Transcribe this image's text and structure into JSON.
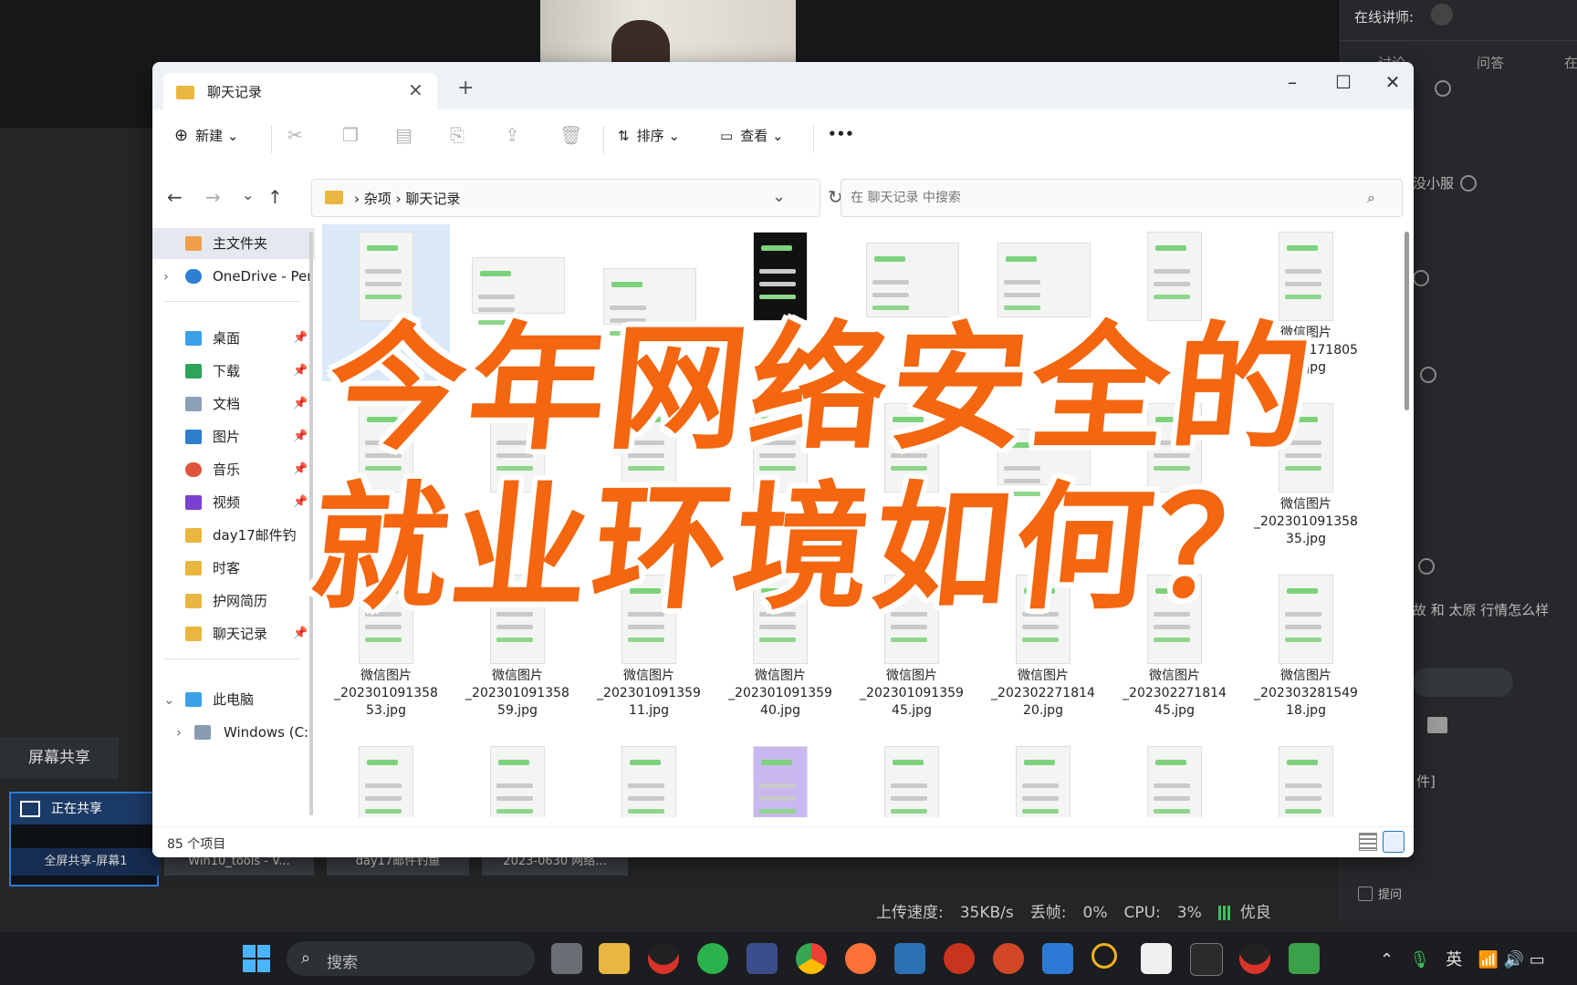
{
  "headline": {
    "line1": "今年网络安全的",
    "line2": "就业环境如何？"
  },
  "conference": {
    "lecturer_label": "在线讲师:",
    "right_tabs": [
      "讨论",
      "问答",
      "在"
    ],
    "right_texts": [
      "没小服",
      "故 和 太原 行情怎么样",
      "件]",
      "提问"
    ],
    "share_tab": "屏幕共享",
    "share_status": "正在共享",
    "thumbnails": [
      "全屏共享-屏幕1",
      "Win10_tools - V...",
      "day17邮件钓鱼",
      "2023-0630 网络..."
    ],
    "status_bar": {
      "upload_label": "上传速度:",
      "upload_value": "35KB/s",
      "drop_label": "丢帧:",
      "drop_value": "0%",
      "cpu_label": "CPU:",
      "cpu_value": "3%",
      "quality": "优良"
    }
  },
  "explorer": {
    "tab_title": "聊天记录",
    "toolbar": {
      "new": "新建",
      "sort": "排序",
      "view": "查看",
      "more": "•••"
    },
    "breadcrumb": [
      "杂项",
      "聊天记录"
    ],
    "search_placeholder": "在 聊天记录 中搜索",
    "sidebar": [
      {
        "label": "主文件夹",
        "icon": "home-icon"
      },
      {
        "label": "OneDrive - Per",
        "icon": "cloud-icon"
      },
      {
        "label": "桌面",
        "icon": "desktop-icon"
      },
      {
        "label": "下载",
        "icon": "download-icon"
      },
      {
        "label": "文档",
        "icon": "document-icon"
      },
      {
        "label": "图片",
        "icon": "picture-icon"
      },
      {
        "label": "音乐",
        "icon": "music-icon"
      },
      {
        "label": "视频",
        "icon": "video-icon"
      },
      {
        "label": "day17邮件钓",
        "icon": "folder-icon"
      },
      {
        "label": "时客",
        "icon": "folder-icon"
      },
      {
        "label": "护网简历",
        "icon": "folder-icon"
      },
      {
        "label": "聊天记录",
        "icon": "folder-icon"
      },
      {
        "label": "此电脑",
        "icon": "computer-icon"
      },
      {
        "label": "Windows (C:)",
        "icon": "drive-icon"
      }
    ],
    "files_row1": [
      "",
      "",
      "",
      "",
      "",
      "",
      "",
      "微信图片\n_202209171805\n10.jpg"
    ],
    "files_row2": [
      "",
      "",
      "",
      "",
      "",
      "",
      "",
      "微信图片\n_202301091358\n35.jpg"
    ],
    "files_row3": [
      "微信图片\n_202301091358\n53.jpg",
      "微信图片\n_202301091358\n59.jpg",
      "微信图片\n_202301091359\n11.jpg",
      "微信图片\n_202301091359\n40.jpg",
      "微信图片\n_202301091359\n45.jpg",
      "微信图片\n_202302271814\n20.jpg",
      "微信图片\n_202302271814\n45.jpg",
      "微信图片\n_202303281549\n18.jpg"
    ],
    "item_count": "85 个项目"
  },
  "taskbar": {
    "search_label": "搜索",
    "input_method": "英"
  }
}
